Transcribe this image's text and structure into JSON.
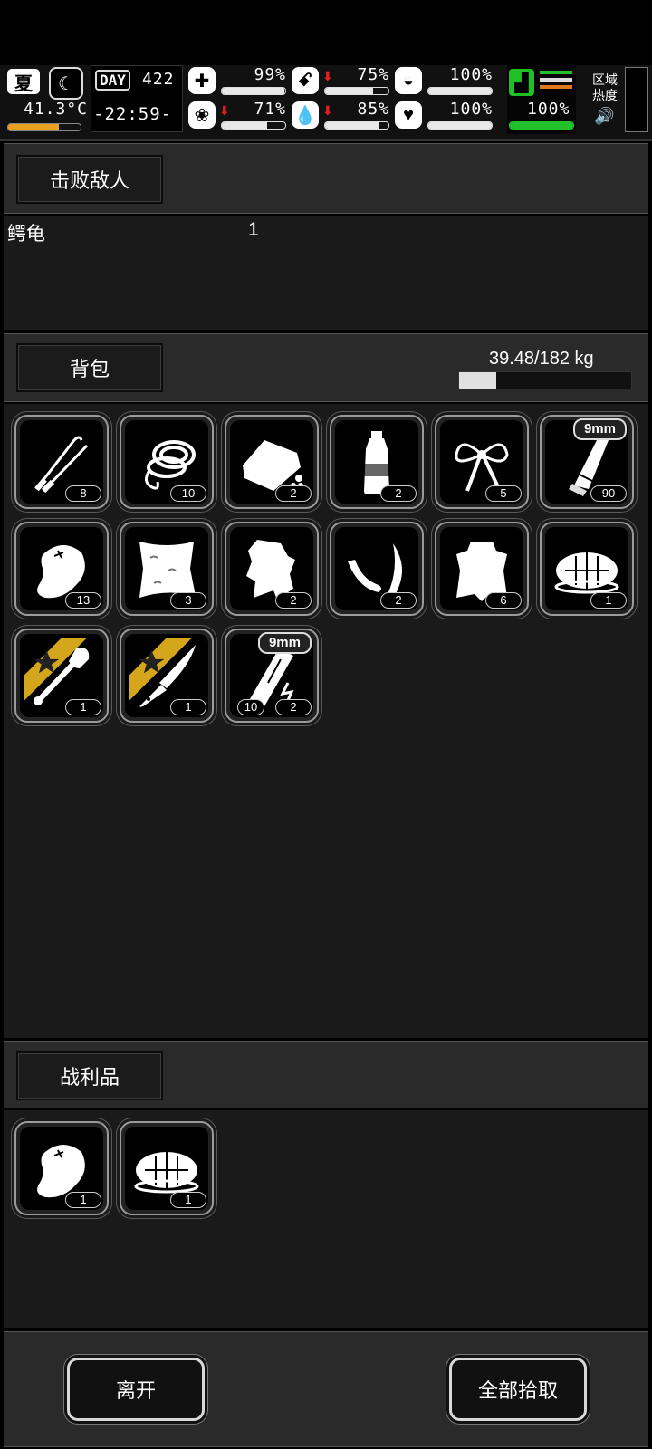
{
  "hud": {
    "season": "夏",
    "temperature": "41.3°C",
    "temperature_level": 0.7,
    "day_label": "DAY",
    "day_number": "422",
    "time": "-22:59-",
    "stats": [
      {
        "icon": "medkit-icon",
        "value": "99%",
        "level": 0.99,
        "down": false
      },
      {
        "icon": "stomach-icon",
        "value": "75%",
        "level": 0.75,
        "down": true
      },
      {
        "icon": "lungs-icon",
        "value": "100%",
        "level": 1.0,
        "down": false
      },
      {
        "icon": "brain-icon",
        "value": "71%",
        "level": 0.71,
        "down": true
      },
      {
        "icon": "water-drop-icon",
        "value": "85%",
        "level": 0.85,
        "down": true
      },
      {
        "icon": "heart-icon",
        "value": "100%",
        "level": 1.0,
        "down": false
      }
    ],
    "stamina": {
      "value": "100%",
      "level": 1.0,
      "color": "#22c02a"
    },
    "zone_heat_label": "区域\n热度"
  },
  "defeated": {
    "tab_label": "击败敌人",
    "enemies": [
      {
        "name": "鳄龟",
        "count": "1"
      }
    ]
  },
  "backpack": {
    "tab_label": "背包",
    "weight": "39.48/182 kg",
    "weight_level": 0.217,
    "items": [
      {
        "icon": "lockpick-icon",
        "count": "8"
      },
      {
        "icon": "rope-icon",
        "count": "10"
      },
      {
        "icon": "bread-icon",
        "count": "2"
      },
      {
        "icon": "water-bottle-icon",
        "count": "2"
      },
      {
        "icon": "cloth-bow-icon",
        "count": "5"
      },
      {
        "icon": "bullet-icon",
        "count": "90",
        "badge": "9mm"
      },
      {
        "icon": "meat-icon",
        "count": "13"
      },
      {
        "icon": "fur-pelt-icon",
        "count": "3"
      },
      {
        "icon": "hide-scrap-icon",
        "count": "2"
      },
      {
        "icon": "horn-icon",
        "count": "2"
      },
      {
        "icon": "animal-pelt-icon",
        "count": "6"
      },
      {
        "icon": "turtle-shell-icon",
        "count": "1"
      },
      {
        "icon": "shovel-icon",
        "count": "1",
        "starred": true
      },
      {
        "icon": "knife-icon",
        "count": "1",
        "starred": true
      },
      {
        "icon": "magazine-icon",
        "count": "2",
        "badge": "9mm",
        "sub_count": "10"
      }
    ]
  },
  "loot": {
    "tab_label": "战利品",
    "items": [
      {
        "icon": "meat-icon",
        "count": "1"
      },
      {
        "icon": "turtle-shell-icon",
        "count": "1"
      }
    ]
  },
  "actions": {
    "leave": "离开",
    "take_all": "全部拾取"
  }
}
